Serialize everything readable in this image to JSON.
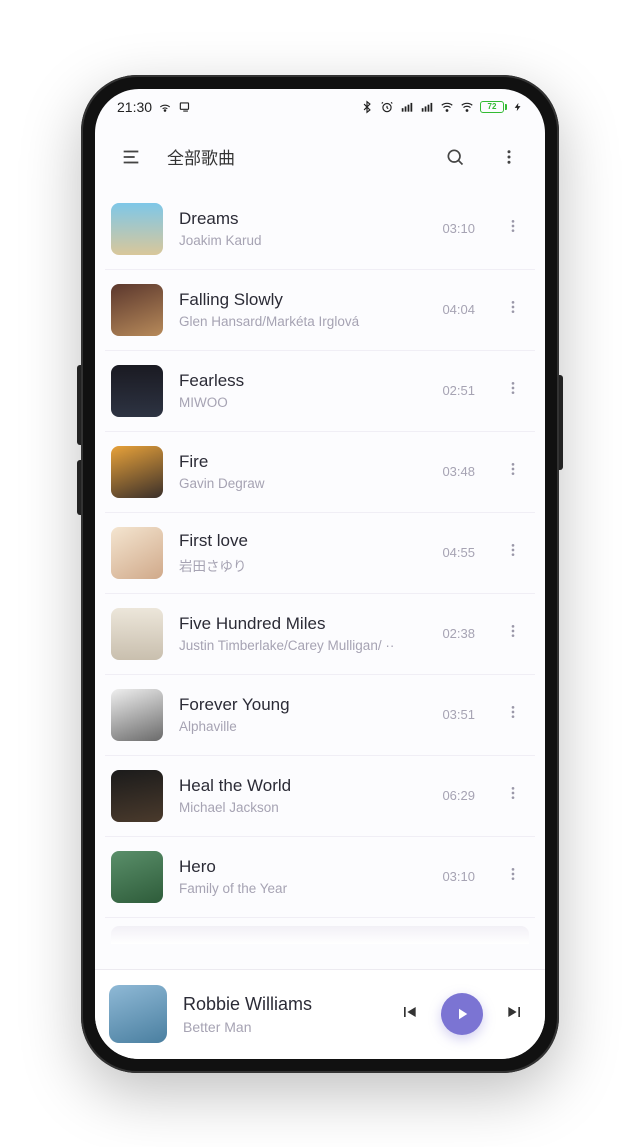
{
  "statusbar": {
    "time": "21:30",
    "battery": "72"
  },
  "header": {
    "title": "全部歌曲"
  },
  "songs": [
    {
      "title": "Dreams",
      "artist": "Joakim Karud",
      "duration": "03:10"
    },
    {
      "title": "Falling Slowly",
      "artist": "Glen Hansard/Markéta Irglová",
      "duration": "04:04"
    },
    {
      "title": "Fearless",
      "artist": "MIWOO",
      "duration": "02:51"
    },
    {
      "title": "Fire",
      "artist": "Gavin Degraw",
      "duration": "03:48"
    },
    {
      "title": "First love",
      "artist": "岩田さゆり",
      "duration": "04:55"
    },
    {
      "title": "Five Hundred Miles",
      "artist": "Justin Timberlake/Carey Mulligan/ ··",
      "duration": "02:38"
    },
    {
      "title": "Forever Young",
      "artist": "Alphaville",
      "duration": "03:51"
    },
    {
      "title": "Heal the World",
      "artist": "Michael Jackson",
      "duration": "06:29"
    },
    {
      "title": "Hero",
      "artist": "Family of the Year",
      "duration": "03:10"
    }
  ],
  "nowplaying": {
    "title": "Robbie Williams",
    "artist": "Better Man"
  }
}
